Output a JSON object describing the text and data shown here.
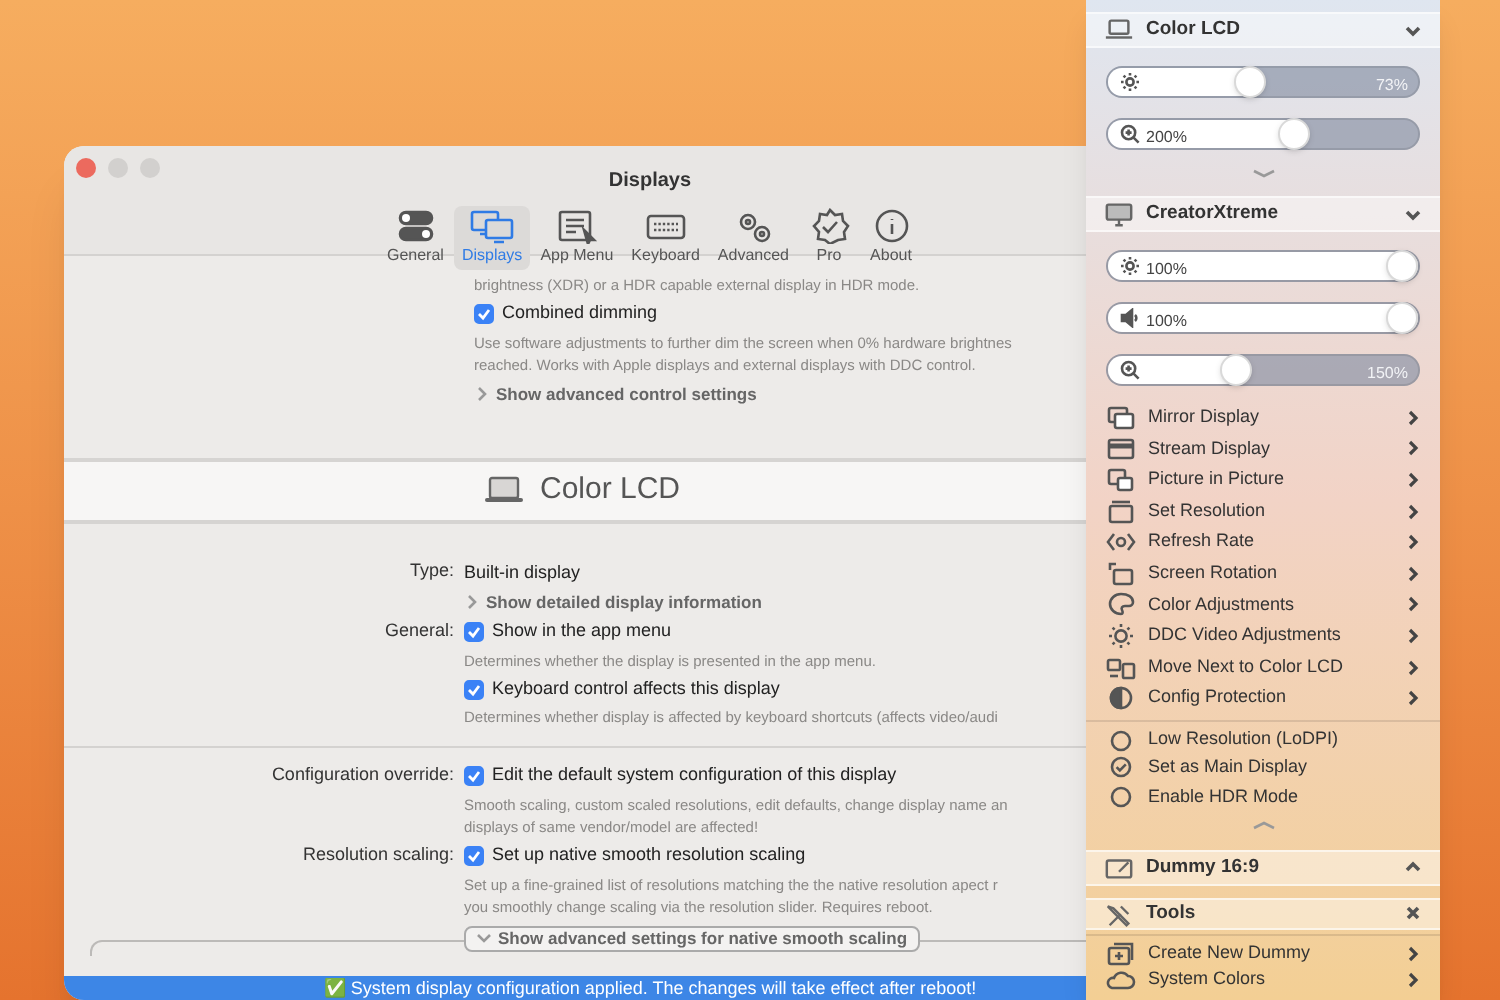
{
  "settings_window": {
    "title": "Displays",
    "toolbar": [
      {
        "label": "General",
        "selected": false
      },
      {
        "label": "Displays",
        "selected": true
      },
      {
        "label": "App Menu",
        "selected": false
      },
      {
        "label": "Keyboard",
        "selected": false
      },
      {
        "label": "Advanced",
        "selected": false
      },
      {
        "label": "Pro",
        "selected": false
      },
      {
        "label": "About",
        "selected": false
      }
    ],
    "top_rows": [
      {
        "kind": "description",
        "text": "brightness (XDR) or a HDR capable external display in HDR mode."
      },
      {
        "kind": "checkbox",
        "label": "Combined dimming",
        "checked": true
      },
      {
        "kind": "description",
        "text": "Use software adjustments to further dim the screen when 0% hardware brightnes\nreached. Works with Apple displays and external displays with DDC control."
      },
      {
        "kind": "disclosure",
        "label": "Show advanced control settings",
        "expanded": false
      }
    ],
    "section_title": "Color LCD",
    "rows": [
      {
        "kind": "text",
        "field": "Type:",
        "text": "Built-in display"
      },
      {
        "kind": "disclosure",
        "label": "Show detailed display information",
        "expanded": false
      },
      {
        "kind": "checkbox",
        "field": "General:",
        "label": "Show in the app menu",
        "checked": true
      },
      {
        "kind": "description",
        "text": "Determines whether the display is presented in the app menu."
      },
      {
        "kind": "checkbox",
        "label": "Keyboard control affects this display",
        "checked": true
      },
      {
        "kind": "description",
        "text": "Determines whether display is affected by keyboard shortcuts (affects video/audi"
      },
      {
        "kind": "divider"
      },
      {
        "kind": "checkbox",
        "field": "Configuration override:",
        "label": "Edit the default system configuration of this display",
        "checked": true
      },
      {
        "kind": "description",
        "text": "Smooth scaling, custom scaled resolutions, edit defaults, change display name an\ndisplays of same vendor/model are affected!"
      },
      {
        "kind": "checkbox",
        "field": "Resolution scaling:",
        "label": "Set up native smooth resolution scaling",
        "checked": true
      },
      {
        "kind": "description",
        "text": "Set up a fine-grained list of resolutions matching the the native resolution apect r\nyou smoothly change scaling via the resolution slider. Requires reboot."
      },
      {
        "kind": "group",
        "label": "Show advanced settings for native smooth scaling",
        "expanded": true
      }
    ],
    "banner": "✅ System display configuration applied. The changes will take effect after reboot!"
  },
  "menu": [
    {
      "kind": "header",
      "title": "Color LCD",
      "expanded": true
    },
    {
      "kind": "slider",
      "level": 0.45,
      "reading": "73%"
    },
    {
      "kind": "slider",
      "level": 0.61,
      "reading": "200%"
    },
    {
      "kind": "more",
      "expanded": false
    },
    {
      "kind": "header",
      "title": "CreatorXtreme",
      "expanded": true
    },
    {
      "kind": "slider",
      "level": 1,
      "reading": "100%"
    },
    {
      "kind": "slider",
      "level": 1,
      "reading": "100%"
    },
    {
      "kind": "slider",
      "level": 0.4,
      "reading": "150%"
    },
    {
      "kind": "item",
      "label": "Mirror Display"
    },
    {
      "kind": "item",
      "label": "Stream Display"
    },
    {
      "kind": "item",
      "label": "Picture in Picture"
    },
    {
      "kind": "item",
      "label": "Set Resolution"
    },
    {
      "kind": "item",
      "label": "Refresh Rate"
    },
    {
      "kind": "item",
      "label": "Screen Rotation"
    },
    {
      "kind": "item",
      "label": "Color Adjustments"
    },
    {
      "kind": "item",
      "label": "DDC Video Adjustments"
    },
    {
      "kind": "item",
      "label": "Move Next to Color LCD"
    },
    {
      "kind": "item",
      "label": "Config Protection"
    },
    {
      "kind": "toggle",
      "label": "Low Resolution (LoDPI)",
      "checked": false
    },
    {
      "kind": "toggle",
      "label": "Set as Main Display",
      "checked": true
    },
    {
      "kind": "toggle",
      "label": "Enable HDR Mode",
      "checked": false
    },
    {
      "kind": "more",
      "expanded": true
    },
    {
      "kind": "header",
      "title": "Dummy 16:9",
      "expanded": false
    },
    {
      "kind": "tools",
      "title": "Tools"
    },
    {
      "kind": "item",
      "label": "Create New Dummy"
    },
    {
      "kind": "item",
      "label": "System Colors"
    }
  ]
}
